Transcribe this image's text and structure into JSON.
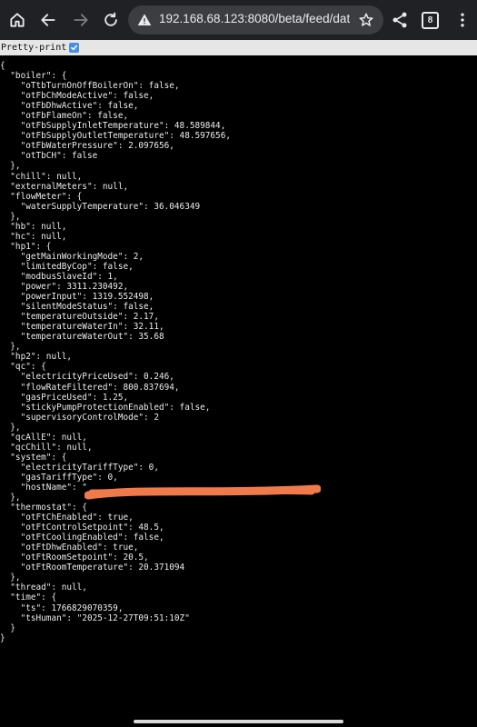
{
  "browser": {
    "url": "192.168.68.123:8080/beta/feed/data.jso",
    "tab_count": "8",
    "icons": [
      "home-icon",
      "back-icon",
      "forward-icon",
      "reload-icon",
      "not-secure-warning-icon",
      "bookmark-star-icon",
      "share-icon",
      "tab-switcher-icon",
      "more-menu-icon"
    ]
  },
  "pretty_print": {
    "label": "Pretty-print",
    "checked": true
  },
  "json_lines": [
    "{",
    "  \"boiler\": {",
    "    \"oTtbTurnOnOffBoilerOn\": false,",
    "    \"otFbChModeActive\": false,",
    "    \"otFbDhwActive\": false,",
    "    \"otFbFlameOn\": false,",
    "    \"otFbSupplyInletTemperature\": 48.589844,",
    "    \"otFbSupplyOutletTemperature\": 48.597656,",
    "    \"otFbWaterPressure\": 2.097656,",
    "    \"otTbCH\": false",
    "  },",
    "  \"chill\": null,",
    "  \"externalMeters\": null,",
    "  \"flowMeter\": {",
    "    \"waterSupplyTemperature\": 36.046349",
    "  },",
    "  \"hb\": null,",
    "  \"hc\": null,",
    "  \"hp1\": {",
    "    \"getMainWorkingMode\": 2,",
    "    \"limitedByCop\": false,",
    "    \"modbusSlaveId\": 1,",
    "    \"power\": 3311.230492,",
    "    \"powerInput\": 1319.552498,",
    "    \"silentModeStatus\": false,",
    "    \"temperatureOutside\": 2.17,",
    "    \"temperatureWaterIn\": 32.11,",
    "    \"temperatureWaterOut\": 35.68",
    "  },",
    "  \"hp2\": null,",
    "  \"qc\": {",
    "    \"electricityPriceUsed\": 0.246,",
    "    \"flowRateFiltered\": 800.837694,",
    "    \"gasPriceUsed\": 1.25,",
    "    \"stickyPumpProtectionEnabled\": false,",
    "    \"supervisoryControlMode\": 2",
    "  },",
    "  \"qcAllE\": null,",
    "  \"qcChill\": null,",
    "  \"system\": {",
    "    \"electricityTariffType\": 0,",
    "    \"gasTariffType\": 0,",
    "    \"hostName\": \"",
    "  },",
    "  \"thermostat\": {",
    "    \"otFtChEnabled\": true,",
    "    \"otFtControlSetpoint\": 48.5,",
    "    \"otFtCoolingEnabled\": false,",
    "    \"otFtDhwEnabled\": true,",
    "    \"otFtRoomSetpoint\": 20.5,",
    "    \"otFtRoomTemperature\": 20.371094",
    "  },",
    "  \"thread\": null,",
    "  \"time\": {",
    "    \"ts\": 1766829070359,",
    "    \"tsHuman\": \"2025-12-27T09:51:10Z\"",
    "  }",
    "}"
  ],
  "redaction_color": "#f07a4a"
}
